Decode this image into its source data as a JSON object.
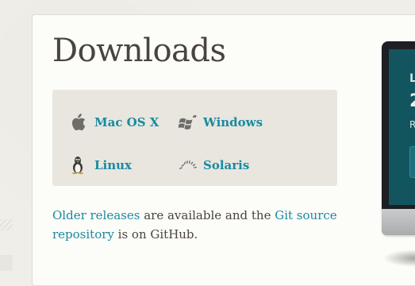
{
  "page": {
    "title": "Downloads"
  },
  "downloads": [
    {
      "label": "Mac OS X",
      "icon": "apple-icon"
    },
    {
      "label": "Windows",
      "icon": "windows-icon"
    },
    {
      "label": "Linux",
      "icon": "tux-icon"
    },
    {
      "label": "Solaris",
      "icon": "solaris-icon"
    }
  ],
  "note": {
    "older_link": "Older releases",
    "middle_text": " are available and the ",
    "git_link": "Git source repository",
    "end_text": " is on GitHub."
  },
  "promo_screen": {
    "line1": "L",
    "line2": "2",
    "line3": "R"
  },
  "colors": {
    "link": "#1a8aa0",
    "text": "#4a4440",
    "box_bg": "#e8e6df",
    "page_bg": "#efeee8"
  }
}
